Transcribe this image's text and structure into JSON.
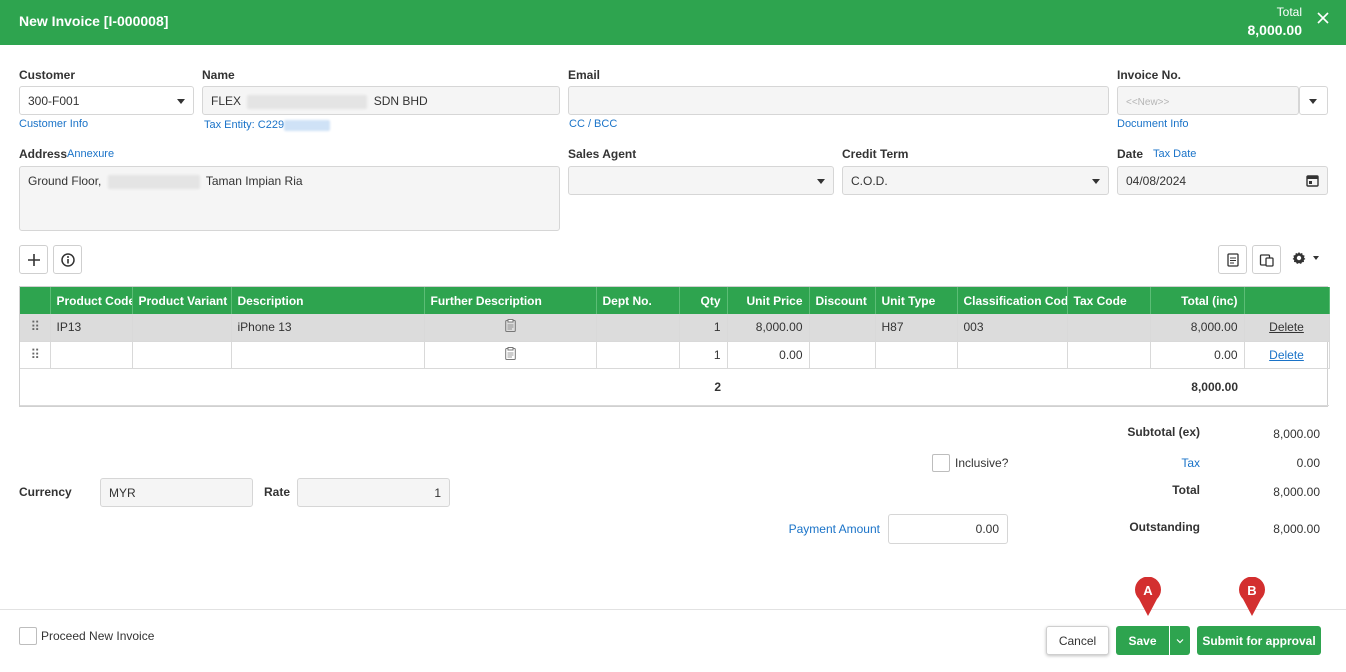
{
  "header": {
    "title": "New Invoice [I-000008]",
    "total_label": "Total",
    "total_value": "8,000.00"
  },
  "colors": {
    "accent": "#2ea44f",
    "link": "#1a73c8",
    "marker": "#d32f2f"
  },
  "customer": {
    "label": "Customer",
    "value": "300-F001",
    "link": "Customer Info"
  },
  "name": {
    "label": "Name",
    "prefix": "FLEX",
    "suffix": "SDN BHD",
    "tax_entity": "Tax Entity: C229"
  },
  "email": {
    "label": "Email",
    "value": "",
    "link": "CC / BCC"
  },
  "invoice_no": {
    "label": "Invoice No.",
    "placeholder": "<<New>>",
    "link": "Document Info"
  },
  "address": {
    "label": "Address",
    "annexure": "Annexure",
    "prefix": "Ground Floor,",
    "suffix": "Taman Impian Ria"
  },
  "sales_agent": {
    "label": "Sales Agent",
    "value": ""
  },
  "credit_term": {
    "label": "Credit Term",
    "value": "C.O.D."
  },
  "date": {
    "label": "Date",
    "tax_date": "Tax Date",
    "value": "04/08/2024"
  },
  "toolbar": {
    "add_icon": "plus-icon",
    "info_icon": "info-icon",
    "gear_icon": "gear-icon"
  },
  "table": {
    "columns": [
      "",
      "Product Code",
      "Product Variant",
      "Description",
      "Further Description",
      "Dept No.",
      "Qty",
      "Unit Price",
      "Discount",
      "Unit Type",
      "Classification Code",
      "Tax Code",
      "Total (inc)",
      ""
    ],
    "rows": [
      {
        "product_code": "IP13",
        "variant": "",
        "description": "iPhone 13",
        "dept": "",
        "qty": "1",
        "unit_price": "8,000.00",
        "discount": "",
        "unit_type": "H87",
        "class_code": "003",
        "tax_code": "",
        "total": "8,000.00",
        "delete": "Delete"
      },
      {
        "product_code": "",
        "variant": "",
        "description": "",
        "dept": "",
        "qty": "1",
        "unit_price": "0.00",
        "discount": "",
        "unit_type": "",
        "class_code": "",
        "tax_code": "",
        "total": "0.00",
        "delete": "Delete"
      }
    ],
    "footer": {
      "qty_total": "2",
      "total": "8,000.00"
    }
  },
  "summary": {
    "subtotal_label": "Subtotal (ex)",
    "subtotal": "8,000.00",
    "inclusive_label": "Inclusive?",
    "tax_label": "Tax",
    "tax": "0.00",
    "total_label": "Total",
    "total": "8,000.00",
    "payment_label": "Payment Amount",
    "payment": "0.00",
    "outstanding_label": "Outstanding",
    "outstanding": "8,000.00"
  },
  "currency": {
    "label": "Currency",
    "value": "MYR",
    "rate_label": "Rate",
    "rate": "1"
  },
  "footer": {
    "proceed_label": "Proceed New Invoice",
    "cancel": "Cancel",
    "save": "Save",
    "submit": "Submit for approval",
    "marker_a": "A",
    "marker_b": "B"
  }
}
